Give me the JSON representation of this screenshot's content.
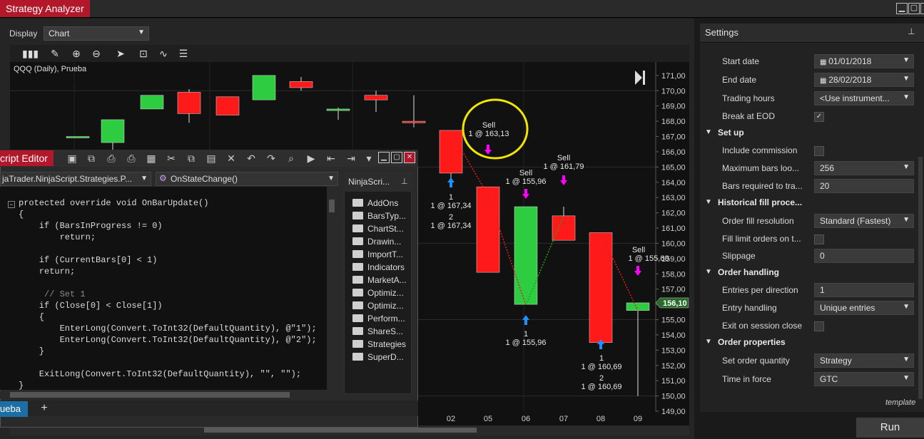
{
  "window": {
    "title": "Strategy Analyzer",
    "buttons": [
      "minimize",
      "maximize",
      "close"
    ]
  },
  "display": {
    "label": "Display",
    "value": "Chart"
  },
  "chart": {
    "title": "QQQ (Daily), Prueba",
    "toolbar_icons": [
      "bar-style-icon",
      "pencil-icon",
      "zoom-in-icon",
      "zoom-out-icon",
      "pointer-icon",
      "data-box-icon",
      "strategy-icon",
      "properties-icon"
    ],
    "last_price": "156,10",
    "annotations": {
      "sell1": "Sell",
      "sell1_qty": "1 @ 163,13",
      "sell2": "Sell",
      "sell2_qty": "1 @ 161,79",
      "sell3": "Sell",
      "sell3_qty": "1 @ 155,96",
      "sell4": "Sell",
      "sell4_qty": "1 @ 155,60",
      "buy1a": "1",
      "buy1a_qty": "1 @ 167,34",
      "buy1b": "2",
      "buy1b_qty": "1 @ 167,34",
      "buy2": "1",
      "buy2_qty": "1 @ 155,96",
      "buy3a": "1",
      "buy3a_qty": "1 @ 160,69",
      "buy3b": "2",
      "buy3b_qty": "1 @ 160,69"
    }
  },
  "chart_data": {
    "type": "candlestick",
    "title": "QQQ (Daily), Prueba",
    "y_ticks": [
      "171,00",
      "170,00",
      "169,00",
      "168,00",
      "167,00",
      "166,00",
      "165,00",
      "164,00",
      "163,00",
      "162,00",
      "161,00",
      "160,00",
      "159,00",
      "158,00",
      "157,00",
      "156,00",
      "155,00",
      "154,00",
      "153,00",
      "152,00",
      "151,00",
      "150,00",
      "149,00"
    ],
    "ylim": [
      149,
      171.6
    ],
    "x_labels": [
      "02",
      "05",
      "06",
      "07",
      "08",
      "09"
    ],
    "candles": [
      {
        "o": 167.0,
        "h": 167.0,
        "l": 166.9,
        "c": 167.0
      },
      {
        "o": 166.6,
        "h": 168.1,
        "l": 164.7,
        "c": 168.1
      },
      {
        "o": 168.8,
        "h": 169.7,
        "l": 168.8,
        "c": 169.7
      },
      {
        "o": 169.9,
        "h": 170.1,
        "l": 167.9,
        "c": 168.5
      },
      {
        "o": 169.6,
        "h": 169.6,
        "l": 168.4,
        "c": 168.4
      },
      {
        "o": 169.4,
        "h": 171.0,
        "l": 169.4,
        "c": 171.0
      },
      {
        "o": 170.6,
        "h": 170.9,
        "l": 170.0,
        "c": 170.2
      },
      {
        "o": 168.7,
        "h": 168.9,
        "l": 168.1,
        "c": 168.8
      },
      {
        "o": 169.7,
        "h": 170.0,
        "l": 168.6,
        "c": 169.4
      },
      {
        "o": 168.0,
        "h": 169.7,
        "l": 167.6,
        "c": 167.9
      },
      {
        "o": 167.4,
        "h": 167.4,
        "l": 163.9,
        "c": 164.6
      },
      {
        "o": 163.7,
        "h": 163.7,
        "l": 158.1,
        "c": 158.1
      },
      {
        "o": 156.0,
        "h": 162.4,
        "l": 156.0,
        "c": 162.4
      },
      {
        "o": 161.8,
        "h": 162.4,
        "l": 160.2,
        "c": 160.2
      },
      {
        "o": 160.7,
        "h": 160.7,
        "l": 153.5,
        "c": 153.5
      },
      {
        "o": 155.6,
        "h": 155.6,
        "l": 150.0,
        "c": 156.1
      }
    ],
    "last_price": 156.1
  },
  "settings": {
    "title": "Settings",
    "rows": [
      {
        "label": "Start date",
        "value": "01/01/2018",
        "kind": "date"
      },
      {
        "label": "End date",
        "value": "28/02/2018",
        "kind": "date"
      },
      {
        "label": "Trading hours",
        "value": "<Use instrument...",
        "kind": "select"
      },
      {
        "label": "Break at EOD",
        "value": "",
        "kind": "check_on"
      },
      {
        "label": "Set up",
        "kind": "category"
      },
      {
        "label": "Include commission",
        "value": "",
        "kind": "check_off"
      },
      {
        "label": "Maximum bars loo...",
        "value": "256",
        "kind": "select"
      },
      {
        "label": "Bars required to tra...",
        "value": "20",
        "kind": "text"
      },
      {
        "label": "Historical fill proce...",
        "kind": "category"
      },
      {
        "label": "Order fill resolution",
        "value": "Standard (Fastest)",
        "kind": "select"
      },
      {
        "label": "Fill limit orders on t...",
        "value": "",
        "kind": "check_off"
      },
      {
        "label": "Slippage",
        "value": "0",
        "kind": "text"
      },
      {
        "label": "Order handling",
        "kind": "category"
      },
      {
        "label": "Entries per direction",
        "value": "1",
        "kind": "text"
      },
      {
        "label": "Entry handling",
        "value": "Unique entries",
        "kind": "select"
      },
      {
        "label": "Exit on session close",
        "value": "",
        "kind": "check_off"
      },
      {
        "label": "Order properties",
        "kind": "category"
      },
      {
        "label": "Set order quantity",
        "value": "Strategy",
        "kind": "select"
      },
      {
        "label": "Time in force",
        "value": "GTC",
        "kind": "select"
      }
    ],
    "template_link": "template",
    "run_button": "Run"
  },
  "editor": {
    "title": "cript Editor",
    "class_select": "jaTrader.NinjaScript.Strategies.P...",
    "member_select": "OnStateChange()",
    "code": [
      "protected override void OnBarUpdate()",
      "{",
      "    if (BarsInProgress != 0)",
      "        return;",
      "",
      "    if (CurrentBars[0] < 1)",
      "    return;",
      "",
      "     // Set 1",
      "    if (Close[0] < Close[1])",
      "    {",
      "        EnterLong(Convert.ToInt32(DefaultQuantity), @\"1\");",
      "        EnterLong(Convert.ToInt32(DefaultQuantity), @\"2\");",
      "    }",
      "",
      "    ExitLong(Convert.ToInt32(DefaultQuantity), \"\", \"\");",
      "}"
    ],
    "explorer_title": "NinjaScri...",
    "folders": [
      "AddOns",
      "BarsTyp...",
      "ChartSt...",
      "Drawin...",
      "ImportT...",
      "Indicators",
      "MarketA...",
      "Optimiz...",
      "Optimiz...",
      "Perform...",
      "ShareS...",
      "Strategies",
      "SuperD..."
    ],
    "tab_label": "ueba",
    "add_tab": "+"
  },
  "colors": {
    "up": "#2ecc40",
    "down": "#ff1a1a",
    "accent": "#b3172a",
    "highlight": "#f2e600",
    "buy_arrow": "#1e90ff",
    "sell_arrow": "#ff00ff"
  }
}
